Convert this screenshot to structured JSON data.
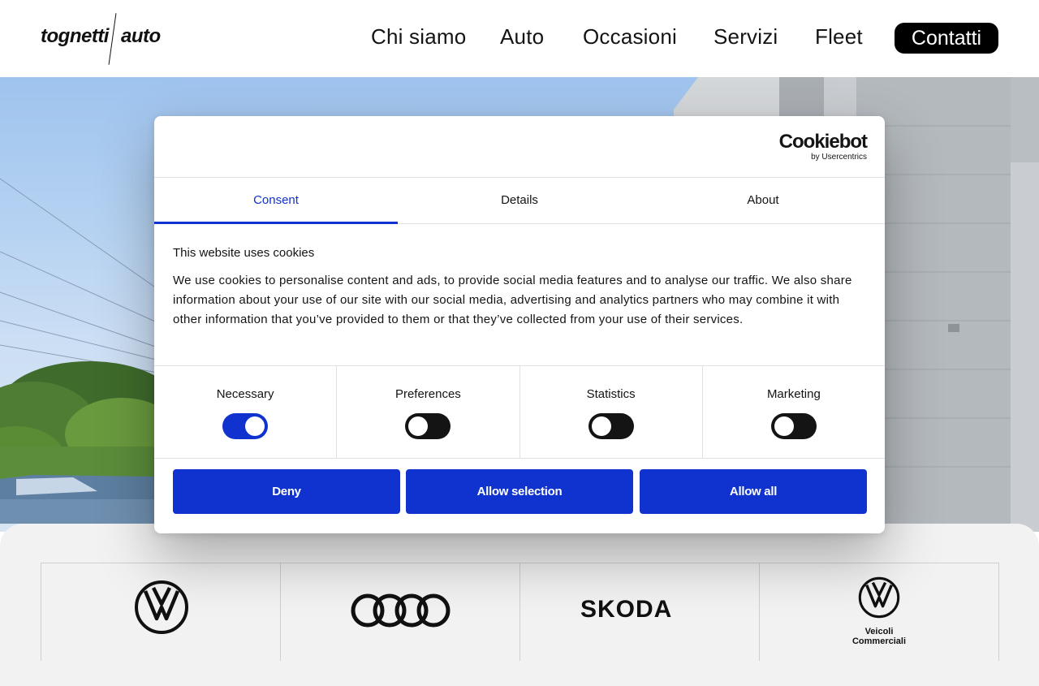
{
  "header": {
    "logo_left": "tognetti",
    "logo_right": "auto",
    "nav": [
      "Chi siamo",
      "Auto",
      "Occasioni",
      "Servizi",
      "Fleet"
    ],
    "contact_label": "Contatti"
  },
  "cookie_dialog": {
    "brand": "Cookiebot",
    "brand_sub": "by Usercentrics",
    "tabs": [
      "Consent",
      "Details",
      "About"
    ],
    "active_tab": "Consent",
    "heading": "This website uses cookies",
    "text": "We use cookies to personalise content and ads, to provide social media features and to analyse our traffic. We also share information about your use of our site with our social media, advertising and analytics partners who may combine it with other information that you’ve provided to them or that they’ve collected from your use of their services.",
    "toggles": [
      {
        "label": "Necessary",
        "on": true
      },
      {
        "label": "Preferences",
        "on": false
      },
      {
        "label": "Statistics",
        "on": false
      },
      {
        "label": "Marketing",
        "on": false
      }
    ],
    "buttons": {
      "deny": "Deny",
      "allow_selection": "Allow selection",
      "allow_all": "Allow all"
    },
    "accent_color": "#1032cf"
  },
  "brands": {
    "skoda_label": "SKODA",
    "vw_commercial_line1": "Veicoli",
    "vw_commercial_line2": "Commerciali",
    "items": [
      "volkswagen-logo",
      "audi-logo",
      "skoda-logo",
      "vw-commercial-logo"
    ]
  }
}
